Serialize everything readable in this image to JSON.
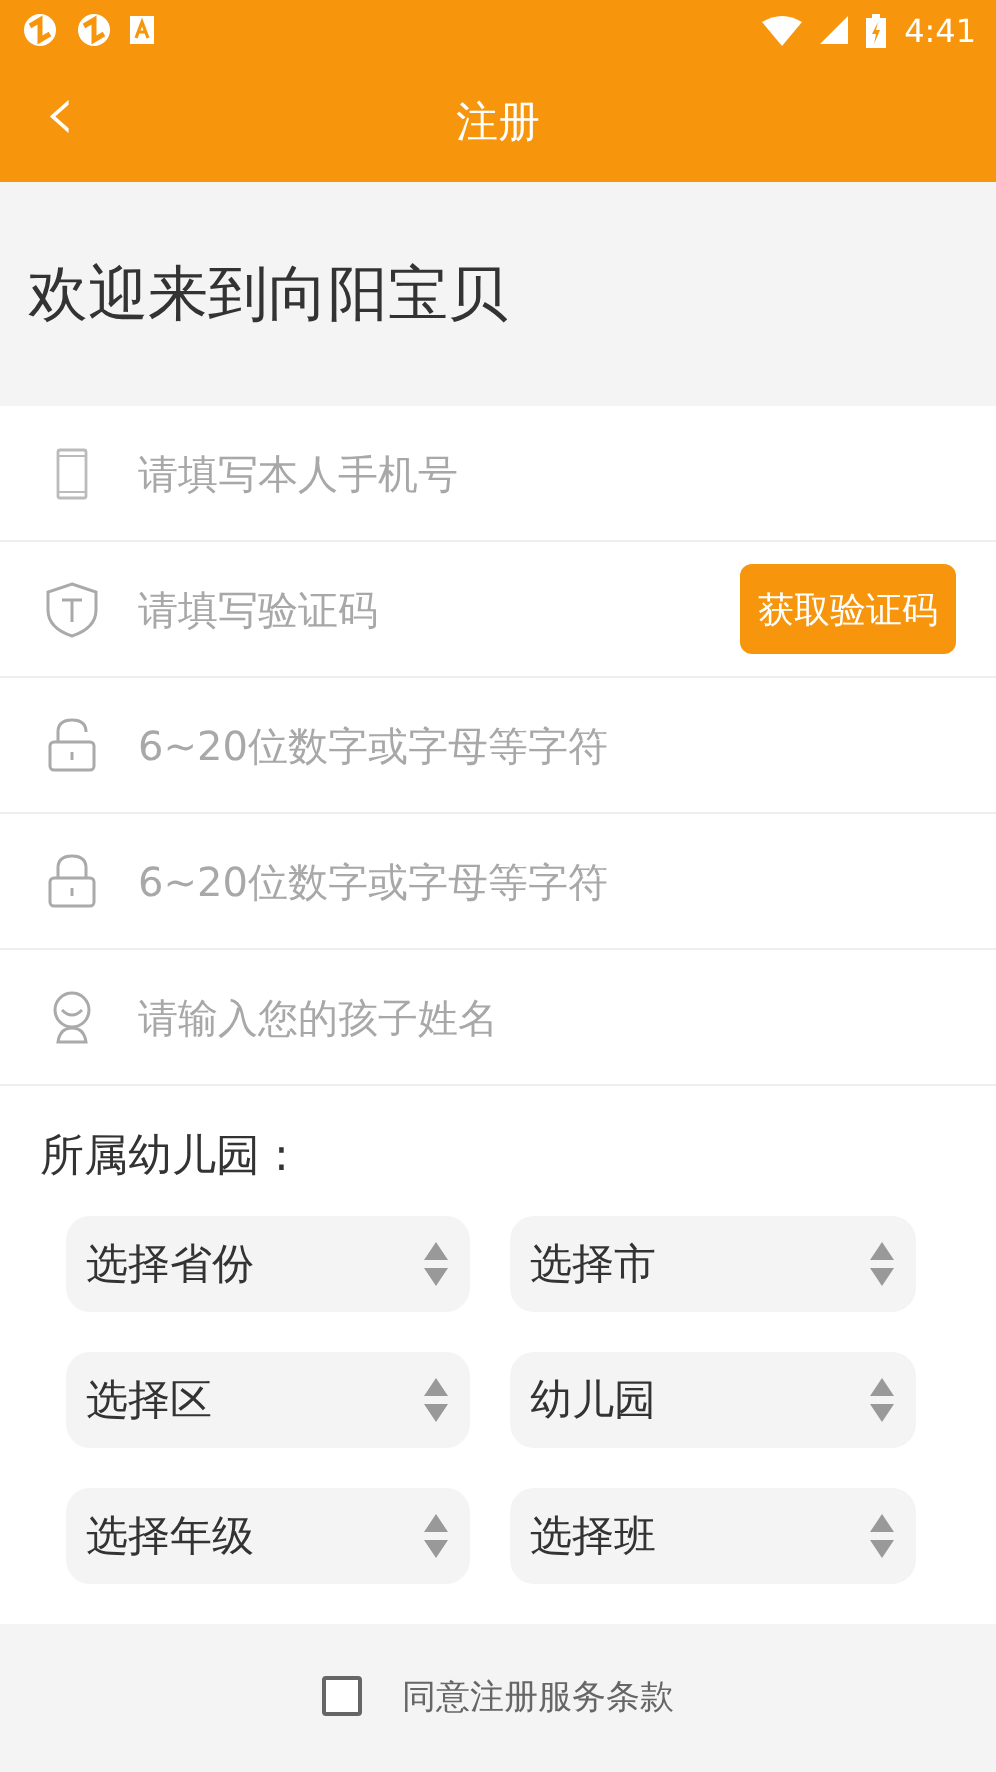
{
  "status_bar": {
    "time": "4:41"
  },
  "app_bar": {
    "title": "注册",
    "back": "‹"
  },
  "welcome": "欢迎来到向阳宝贝",
  "fields": [
    {
      "placeholder": "请填写本人手机号"
    },
    {
      "placeholder": "请填写验证码",
      "button": "获取验证码"
    },
    {
      "placeholder": "6~20位数字或字母等字符"
    },
    {
      "placeholder": "6~20位数字或字母等字符"
    },
    {
      "placeholder": "请输入您的孩子姓名"
    }
  ],
  "kindergarten": {
    "label": "所属幼儿园 :",
    "selects": [
      {
        "value": "选择省份"
      },
      {
        "value": "选择市"
      },
      {
        "value": "选择区"
      },
      {
        "value": "幼儿园"
      },
      {
        "value": "选择年级"
      },
      {
        "value": "选择班"
      }
    ]
  },
  "agreement": {
    "label": "同意注册服务条款",
    "checked": false
  }
}
